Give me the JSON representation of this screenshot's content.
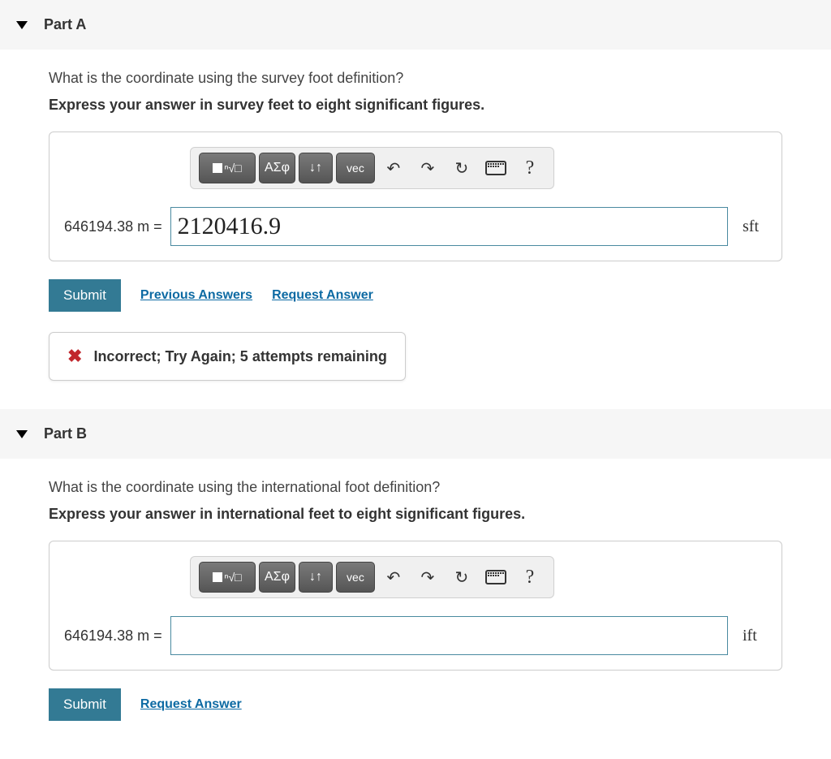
{
  "parts": [
    {
      "title": "Part A",
      "question": "What is the coordinate using the survey foot definition?",
      "instruction": "Express your answer in survey feet to eight significant figures.",
      "lhs_value": "646194.38",
      "lhs_unit": "m",
      "equals": "=",
      "input_value": "2120416.9",
      "unit": "sft",
      "submit_label": "Submit",
      "links": [
        {
          "label": "Previous Answers"
        },
        {
          "label": "Request Answer"
        }
      ],
      "feedback": "Incorrect; Try Again; 5 attempts remaining",
      "has_feedback": true
    },
    {
      "title": "Part B",
      "question": "What is the coordinate using the international foot definition?",
      "instruction": "Express your answer in international feet to eight significant figures.",
      "lhs_value": "646194.38",
      "lhs_unit": "m",
      "equals": "=",
      "input_value": "",
      "unit": "ift",
      "submit_label": "Submit",
      "links": [
        {
          "label": "Request Answer"
        }
      ],
      "has_feedback": false
    }
  ],
  "toolbar": {
    "greek": "ΑΣφ",
    "vec": "vec",
    "help": "?"
  }
}
